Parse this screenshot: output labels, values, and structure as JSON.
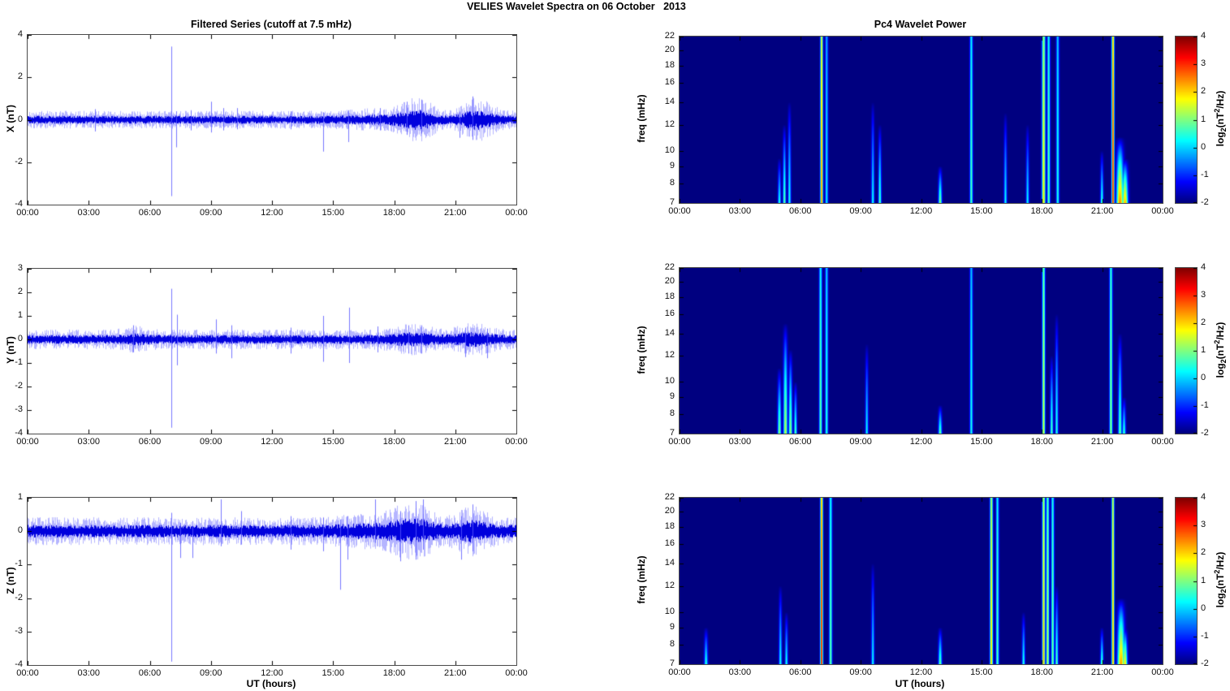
{
  "title": "VELIES Wavelet Spectra on 06 October   2013",
  "left_column_title": "Filtered Series (cutoff at 7.5 mHz)",
  "right_column_title": "Pc4 Wavelet Power",
  "xlabel_left": "UT (hours)",
  "xlabel_right": "UT (hours)",
  "colorbar_label": {
    "prefix": "log",
    "sub": "2",
    "mid": "(nT",
    "sup": "2",
    "suffix": "/Hz)"
  },
  "colors": {
    "line": "#0000dd",
    "line_light": "#6a6aff",
    "background": "#ffffff",
    "heat_min": "#000083",
    "axis": "#4a4a4a"
  },
  "chart_data": [
    {
      "id": "ts-x",
      "type": "line",
      "title": "Filtered Series (cutoff at 7.5 mHz)",
      "ylabel": "X (nT)",
      "ylim": [
        -4,
        4
      ],
      "yticks": [
        4,
        2,
        0,
        -2,
        -4
      ],
      "xlim_hours": [
        0,
        24
      ],
      "xtick_hours": [
        0,
        3,
        6,
        9,
        12,
        15,
        18,
        21,
        24
      ],
      "xtick_labels": [
        "00:00",
        "03:00",
        "06:00",
        "09:00",
        "12:00",
        "15:00",
        "18:00",
        "21:00",
        "00:00"
      ],
      "noise_amp": 0.2,
      "bursts": [
        {
          "t": 17.0,
          "w": 1.0,
          "m": 0.3
        },
        {
          "t": 18.7,
          "w": 0.5,
          "m": 0.8
        },
        {
          "t": 19.4,
          "w": 0.5,
          "m": 1.1
        },
        {
          "t": 21.9,
          "w": 0.5,
          "m": 1.3
        },
        {
          "t": 22.6,
          "w": 0.5,
          "m": 0.5
        }
      ],
      "spikes": [
        {
          "t": 3.3,
          "up": 0.5,
          "down": -0.55
        },
        {
          "t": 7.05,
          "up": 3.45,
          "down": -3.6
        },
        {
          "t": 7.3,
          "up": 0.4,
          "down": -1.3
        },
        {
          "t": 8.0,
          "up": 0.45,
          "down": -0.5
        },
        {
          "t": 9.0,
          "up": 0.85,
          "down": -0.6
        },
        {
          "t": 9.6,
          "up": 0.55,
          "down": -0.5
        },
        {
          "t": 10.3,
          "up": 0.55,
          "down": -0.45
        },
        {
          "t": 12.9,
          "up": 0.4,
          "down": -0.45
        },
        {
          "t": 14.5,
          "up": 0.35,
          "down": -1.5
        },
        {
          "t": 15.75,
          "up": 0.45,
          "down": -1.05
        },
        {
          "t": 17.3,
          "up": 0.55,
          "down": -0.5
        },
        {
          "t": 18.6,
          "up": 0.85,
          "down": -0.7
        },
        {
          "t": 19.35,
          "up": 0.95,
          "down": -0.65
        },
        {
          "t": 21.2,
          "up": 0.35,
          "down": -0.85
        },
        {
          "t": 21.85,
          "up": 1.1,
          "down": -0.95
        }
      ]
    },
    {
      "id": "ts-y",
      "type": "line",
      "ylabel": "Y (nT)",
      "ylim": [
        -4,
        3
      ],
      "yticks": [
        3,
        2,
        1,
        0,
        -1,
        -2,
        -3,
        -4
      ],
      "xlim_hours": [
        0,
        24
      ],
      "xtick_hours": [
        0,
        3,
        6,
        9,
        12,
        15,
        18,
        21,
        24
      ],
      "xtick_labels": [
        "00:00",
        "03:00",
        "06:00",
        "09:00",
        "12:00",
        "15:00",
        "18:00",
        "21:00",
        "00:00"
      ],
      "noise_amp": 0.2,
      "bursts": [
        {
          "t": 5.3,
          "w": 0.5,
          "m": 0.4
        },
        {
          "t": 18.9,
          "w": 0.8,
          "m": 0.6
        },
        {
          "t": 21.9,
          "w": 0.7,
          "m": 0.7
        }
      ],
      "spikes": [
        {
          "t": 5.2,
          "up": 0.6,
          "down": -0.55
        },
        {
          "t": 7.05,
          "up": 2.15,
          "down": -3.75
        },
        {
          "t": 7.35,
          "up": 1.05,
          "down": -1.1
        },
        {
          "t": 9.25,
          "up": 0.85,
          "down": -0.6
        },
        {
          "t": 10.0,
          "up": 0.6,
          "down": -0.8
        },
        {
          "t": 12.9,
          "up": 0.5,
          "down": -0.6
        },
        {
          "t": 14.5,
          "up": 1.0,
          "down": -0.95
        },
        {
          "t": 15.8,
          "up": 1.35,
          "down": -1.0
        },
        {
          "t": 17.2,
          "up": 0.55,
          "down": -0.55
        },
        {
          "t": 18.7,
          "up": 0.6,
          "down": -0.6
        },
        {
          "t": 19.35,
          "up": 0.6,
          "down": -0.6
        },
        {
          "t": 21.5,
          "up": 0.5,
          "down": -0.75
        },
        {
          "t": 22.55,
          "up": 0.45,
          "down": -0.8
        }
      ]
    },
    {
      "id": "ts-z",
      "type": "line",
      "xlabel": "UT (hours)",
      "ylabel": "Z (nT)",
      "ylim": [
        -4,
        1
      ],
      "yticks": [
        1,
        0,
        -1,
        -2,
        -3,
        -4
      ],
      "xlim_hours": [
        0,
        24
      ],
      "xtick_hours": [
        0,
        3,
        6,
        9,
        12,
        15,
        18,
        21,
        24
      ],
      "xtick_labels": [
        "00:00",
        "03:00",
        "06:00",
        "09:00",
        "12:00",
        "15:00",
        "18:00",
        "21:00",
        "00:00"
      ],
      "noise_amp": 0.2,
      "bursts": [
        {
          "t": 16.9,
          "w": 1.2,
          "m": 0.3
        },
        {
          "t": 18.2,
          "w": 0.5,
          "m": 0.5
        },
        {
          "t": 19.2,
          "w": 0.6,
          "m": 0.9
        },
        {
          "t": 21.8,
          "w": 0.6,
          "m": 0.8
        }
      ],
      "spikes": [
        {
          "t": 7.05,
          "up": 0.55,
          "down": -3.9
        },
        {
          "t": 7.5,
          "up": 0.25,
          "down": -0.8
        },
        {
          "t": 8.1,
          "up": 0.3,
          "down": -0.8
        },
        {
          "t": 9.5,
          "up": 0.95,
          "down": -0.45
        },
        {
          "t": 10.5,
          "up": 0.6,
          "down": -0.4
        },
        {
          "t": 12.9,
          "up": 0.45,
          "down": -0.55
        },
        {
          "t": 14.5,
          "up": 0.4,
          "down": -0.6
        },
        {
          "t": 15.35,
          "up": 0.35,
          "down": -1.75
        },
        {
          "t": 15.7,
          "up": 0.45,
          "down": -0.85
        },
        {
          "t": 17.05,
          "up": 0.95,
          "down": -0.35
        },
        {
          "t": 18.3,
          "up": 0.6,
          "down": -0.9
        },
        {
          "t": 19.05,
          "up": 0.9,
          "down": -0.85
        },
        {
          "t": 19.4,
          "up": 0.95,
          "down": -0.55
        },
        {
          "t": 21.3,
          "up": 0.45,
          "down": -0.85
        },
        {
          "t": 21.85,
          "up": 0.8,
          "down": -0.6
        }
      ]
    },
    {
      "id": "wav-x",
      "type": "heatmap",
      "title": "Pc4 Wavelet Power",
      "ylabel": "freq (mHz)",
      "flim": [
        7,
        22
      ],
      "yticks": [
        22,
        20,
        18,
        16,
        14,
        12,
        10,
        9,
        8,
        7
      ],
      "xlim_hours": [
        0,
        24
      ],
      "xtick_hours": [
        0,
        3,
        6,
        9,
        12,
        15,
        18,
        21,
        24
      ],
      "xtick_labels": [
        "00:00",
        "03:00",
        "06:00",
        "09:00",
        "12:00",
        "15:00",
        "18:00",
        "21:00",
        "00:00"
      ],
      "clim": [
        -2,
        4
      ],
      "cticks": [
        4,
        3,
        2,
        1,
        0,
        -1,
        -2
      ],
      "features": [
        {
          "t": 4.95,
          "w": 0.05,
          "ftop": 9.5,
          "peak": 0.5
        },
        {
          "t": 5.2,
          "w": 0.05,
          "ftop": 12,
          "peak": 0.9
        },
        {
          "t": 5.45,
          "w": 0.05,
          "ftop": 14,
          "peak": 0.45
        },
        {
          "t": 7.05,
          "w": 0.045,
          "ftop": 22,
          "peak": 2.6,
          "full": true
        },
        {
          "t": 7.3,
          "w": 0.05,
          "ftop": 22,
          "peak": 0.2,
          "full": true
        },
        {
          "t": 9.6,
          "w": 0.05,
          "ftop": 14,
          "peak": 0.35
        },
        {
          "t": 9.95,
          "w": 0.05,
          "ftop": 12,
          "peak": 0.8
        },
        {
          "t": 12.95,
          "w": 0.06,
          "ftop": 9,
          "peak": 1.1
        },
        {
          "t": 14.5,
          "w": 0.05,
          "ftop": 22,
          "peak": 0.75,
          "full": true
        },
        {
          "t": 16.2,
          "w": 0.05,
          "ftop": 13,
          "peak": 0.3
        },
        {
          "t": 17.3,
          "w": 0.05,
          "ftop": 12,
          "peak": 0.3
        },
        {
          "t": 18.1,
          "w": 0.06,
          "ftop": 22,
          "peak": 1.9,
          "full": true
        },
        {
          "t": 18.35,
          "w": 0.05,
          "ftop": 22,
          "peak": 0.9,
          "full": true
        },
        {
          "t": 18.8,
          "w": 0.05,
          "ftop": 22,
          "peak": 0.5,
          "full": true
        },
        {
          "t": 21.0,
          "w": 0.05,
          "ftop": 10,
          "peak": 0.6
        },
        {
          "t": 21.55,
          "w": 0.045,
          "ftop": 22,
          "peak": 3.3,
          "full": true
        },
        {
          "t": 21.9,
          "w": 0.12,
          "ftop": 11,
          "peak": 2.5
        },
        {
          "t": 22.15,
          "w": 0.1,
          "ftop": 9.5,
          "peak": 2.2
        }
      ]
    },
    {
      "id": "wav-y",
      "type": "heatmap",
      "ylabel": "freq (mHz)",
      "flim": [
        7,
        22
      ],
      "yticks": [
        22,
        20,
        18,
        16,
        14,
        12,
        10,
        9,
        8,
        7
      ],
      "xlim_hours": [
        0,
        24
      ],
      "xtick_hours": [
        0,
        3,
        6,
        9,
        12,
        15,
        18,
        21,
        24
      ],
      "xtick_labels": [
        "00:00",
        "03:00",
        "06:00",
        "09:00",
        "12:00",
        "15:00",
        "18:00",
        "21:00",
        "00:00"
      ],
      "clim": [
        -2,
        4
      ],
      "cticks": [
        4,
        3,
        2,
        1,
        0,
        -1,
        -2
      ],
      "features": [
        {
          "t": 4.95,
          "w": 0.06,
          "ftop": 11,
          "peak": 1.1
        },
        {
          "t": 5.25,
          "w": 0.07,
          "ftop": 15,
          "peak": 1.4
        },
        {
          "t": 5.5,
          "w": 0.06,
          "ftop": 12.5,
          "peak": 1.2
        },
        {
          "t": 5.75,
          "w": 0.05,
          "ftop": 10,
          "peak": 0.8
        },
        {
          "t": 7.0,
          "w": 0.05,
          "ftop": 22,
          "peak": 0.9,
          "full": true
        },
        {
          "t": 7.3,
          "w": 0.05,
          "ftop": 22,
          "peak": 0.5,
          "full": true
        },
        {
          "t": 9.3,
          "w": 0.05,
          "ftop": 13,
          "peak": 0.3
        },
        {
          "t": 12.95,
          "w": 0.06,
          "ftop": 8.5,
          "peak": 0.9
        },
        {
          "t": 14.5,
          "w": 0.05,
          "ftop": 22,
          "peak": 0.4,
          "full": true
        },
        {
          "t": 18.1,
          "w": 0.05,
          "ftop": 22,
          "peak": 1.6,
          "full": true
        },
        {
          "t": 18.5,
          "w": 0.05,
          "ftop": 12,
          "peak": 0.8
        },
        {
          "t": 18.75,
          "w": 0.05,
          "ftop": 16,
          "peak": 0.5
        },
        {
          "t": 21.45,
          "w": 0.05,
          "ftop": 22,
          "peak": 1.2,
          "full": true
        },
        {
          "t": 21.9,
          "w": 0.06,
          "ftop": 14,
          "peak": 0.9
        },
        {
          "t": 22.1,
          "w": 0.06,
          "ftop": 9,
          "peak": 0.6
        }
      ]
    },
    {
      "id": "wav-z",
      "type": "heatmap",
      "xlabel": "UT (hours)",
      "ylabel": "freq (mHz)",
      "flim": [
        7,
        22
      ],
      "yticks": [
        22,
        20,
        18,
        16,
        14,
        12,
        10,
        9,
        8,
        7
      ],
      "xlim_hours": [
        0,
        24
      ],
      "xtick_hours": [
        0,
        3,
        6,
        9,
        12,
        15,
        18,
        21,
        24
      ],
      "xtick_labels": [
        "00:00",
        "03:00",
        "06:00",
        "09:00",
        "12:00",
        "15:00",
        "18:00",
        "21:00",
        "00:00"
      ],
      "clim": [
        -2,
        4
      ],
      "cticks": [
        4,
        3,
        2,
        1,
        0,
        -1,
        -2
      ],
      "features": [
        {
          "t": 1.3,
          "w": 0.06,
          "ftop": 9,
          "peak": 0.5
        },
        {
          "t": 5.0,
          "w": 0.05,
          "ftop": 12,
          "peak": 0.4
        },
        {
          "t": 5.3,
          "w": 0.05,
          "ftop": 10,
          "peak": 0.4
        },
        {
          "t": 7.05,
          "w": 0.045,
          "ftop": 22,
          "peak": 3.4,
          "full": true
        },
        {
          "t": 7.5,
          "w": 0.05,
          "ftop": 22,
          "peak": 0.9,
          "full": true
        },
        {
          "t": 9.6,
          "w": 0.05,
          "ftop": 14,
          "peak": 0.3
        },
        {
          "t": 12.95,
          "w": 0.06,
          "ftop": 9,
          "peak": 0.9
        },
        {
          "t": 15.5,
          "w": 0.05,
          "ftop": 22,
          "peak": 2.1,
          "full": true
        },
        {
          "t": 15.8,
          "w": 0.05,
          "ftop": 22,
          "peak": 0.8,
          "full": true
        },
        {
          "t": 17.1,
          "w": 0.05,
          "ftop": 10,
          "peak": 0.5
        },
        {
          "t": 18.1,
          "w": 0.05,
          "ftop": 22,
          "peak": 2.2,
          "full": true
        },
        {
          "t": 18.3,
          "w": 0.05,
          "ftop": 22,
          "peak": 1.5,
          "full": true
        },
        {
          "t": 18.55,
          "w": 0.05,
          "ftop": 22,
          "peak": 1.0,
          "full": true
        },
        {
          "t": 18.75,
          "w": 0.05,
          "ftop": 12,
          "peak": 0.8
        },
        {
          "t": 21.0,
          "w": 0.05,
          "ftop": 9,
          "peak": 0.8
        },
        {
          "t": 21.55,
          "w": 0.045,
          "ftop": 22,
          "peak": 2.4,
          "full": true
        },
        {
          "t": 21.95,
          "w": 0.12,
          "ftop": 11,
          "peak": 2.4
        },
        {
          "t": 22.15,
          "w": 0.08,
          "ftop": 9,
          "peak": 1.9
        }
      ]
    }
  ]
}
